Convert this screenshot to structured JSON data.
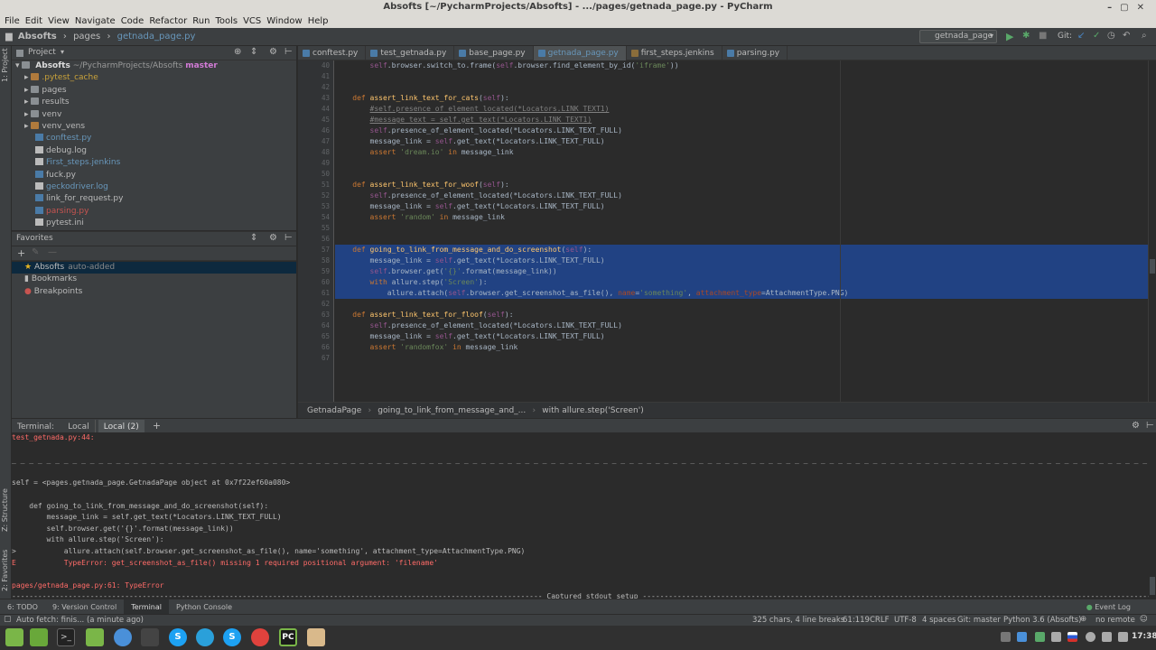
{
  "window": {
    "title": "Absofts [~/PycharmProjects/Absofts] - .../pages/getnada_page.py - PyCharm"
  },
  "menu": [
    "File",
    "Edit",
    "View",
    "Navigate",
    "Code",
    "Refactor",
    "Run",
    "Tools",
    "VCS",
    "Window",
    "Help"
  ],
  "nav": {
    "crumbs": [
      "Absofts",
      "pages",
      "getnada_page.py"
    ],
    "run_config": "getnada_page",
    "git_label": "Git:"
  },
  "left_strip": {
    "project": "1: Project",
    "structure": "Z: Structure",
    "favorites": "2: Favorites"
  },
  "project": {
    "header": "Project",
    "root_name": "Absofts",
    "root_path": "~/PycharmProjects/Absofts",
    "root_branch": "master",
    "items": [
      {
        "name": ".pytest_cache",
        "kind": "folder-orange",
        "color": "#c9a23a"
      },
      {
        "name": "pages",
        "kind": "folder",
        "color": "#bbbbbb"
      },
      {
        "name": "results",
        "kind": "folder",
        "color": "#bbbbbb"
      },
      {
        "name": "venv",
        "kind": "folder",
        "color": "#bbbbbb"
      },
      {
        "name": "venv_vens",
        "kind": "folder-orange",
        "color": "#bbbbbb"
      },
      {
        "name": "conftest.py",
        "kind": "py",
        "color": "#6897bb"
      },
      {
        "name": "debug.log",
        "kind": "txt",
        "color": "#bbbbbb"
      },
      {
        "name": "First_steps.jenkins",
        "kind": "txt",
        "color": "#6897bb"
      },
      {
        "name": "fuck.py",
        "kind": "py",
        "color": "#bbbbbb"
      },
      {
        "name": "geckodriver.log",
        "kind": "txt",
        "color": "#6897bb"
      },
      {
        "name": "link_for_request.py",
        "kind": "py",
        "color": "#bbbbbb"
      },
      {
        "name": "parsing.py",
        "kind": "py",
        "color": "#c75450"
      },
      {
        "name": "pytest.ini",
        "kind": "txt",
        "color": "#bbbbbb"
      }
    ]
  },
  "favorites": {
    "header": "Favorites",
    "items": [
      {
        "name": "Absofts",
        "note": "auto-added",
        "icon": "star-icon"
      },
      {
        "name": "Bookmarks",
        "note": "",
        "icon": "bookmark-icon"
      },
      {
        "name": "Breakpoints",
        "note": "",
        "icon": "breakpoint-icon"
      }
    ]
  },
  "editor": {
    "tabs": [
      {
        "label": "conftest.py",
        "active": false
      },
      {
        "label": "test_getnada.py",
        "active": false
      },
      {
        "label": "base_page.py",
        "active": false
      },
      {
        "label": "getnada_page.py",
        "active": true
      },
      {
        "label": "first_steps.jenkins",
        "active": false
      },
      {
        "label": "parsing.py",
        "active": false
      }
    ],
    "lines": [
      {
        "n": "40",
        "html": "        <span class=\"slf\">self</span>.browser.switch_to.frame(<span class=\"slf\">self</span>.browser.find_element_by_id(<span class=\"str\">'iframe'</span>))",
        "sel": false
      },
      {
        "n": "41",
        "html": "",
        "sel": false
      },
      {
        "n": "42",
        "html": "",
        "sel": false
      },
      {
        "n": "43",
        "html": "    <span class=\"kw\">def</span> <span class=\"fn\">assert_link_text_for_cats</span>(<span class=\"slf\">self</span>):",
        "sel": false
      },
      {
        "n": "44",
        "html": "        <span class=\"cmt\">#self.presence_of_element_located(*Locators.LINK_TEXT1)</span>",
        "sel": false
      },
      {
        "n": "45",
        "html": "        <span class=\"cmt\">#message_text = self.get_text(*Locators.LINK_TEXT1)</span>",
        "sel": false
      },
      {
        "n": "46",
        "html": "        <span class=\"slf\">self</span>.presence_of_element_located(*Locators.LINK_TEXT_FULL)",
        "sel": false
      },
      {
        "n": "47",
        "html": "        message_link = <span class=\"slf\">self</span>.get_text(*Locators.LINK_TEXT_FULL)",
        "sel": false
      },
      {
        "n": "48",
        "html": "        <span class=\"kw\">assert</span> <span class=\"str\">'dream.io'</span> <span class=\"kw\">in</span> message_link",
        "sel": false
      },
      {
        "n": "49",
        "html": "",
        "sel": false
      },
      {
        "n": "50",
        "html": "",
        "sel": false
      },
      {
        "n": "51",
        "html": "    <span class=\"kw\">def</span> <span class=\"fn\">assert_link_text_for_woof</span>(<span class=\"slf\">self</span>):",
        "sel": false
      },
      {
        "n": "52",
        "html": "        <span class=\"slf\">self</span>.presence_of_element_located(*Locators.LINK_TEXT_FULL)",
        "sel": false
      },
      {
        "n": "53",
        "html": "        message_link = <span class=\"slf\">self</span>.get_text(*Locators.LINK_TEXT_FULL)",
        "sel": false
      },
      {
        "n": "54",
        "html": "        <span class=\"kw\">assert</span> <span class=\"str\">'random'</span> <span class=\"kw\">in</span> message_link",
        "sel": false
      },
      {
        "n": "55",
        "html": "",
        "sel": false
      },
      {
        "n": "56",
        "html": "",
        "sel": false
      },
      {
        "n": "57",
        "html": "    <span class=\"kw\">def</span> <span class=\"fn\">going_to_link_from_message_and_do_screenshot</span>(<span class=\"slf\">self</span>):",
        "sel": true
      },
      {
        "n": "58",
        "html": "        message_link = <span class=\"slf\">self</span>.get_text(*Locators.LINK_TEXT_FULL)",
        "sel": true
      },
      {
        "n": "59",
        "html": "        <span class=\"slf\">self</span>.browser.get(<span class=\"str\">'{}'</span>.format(message_link))",
        "sel": true
      },
      {
        "n": "60",
        "html": "        <span class=\"kw\">with</span> allure.step(<span class=\"str\">'Screen'</span>):",
        "sel": true
      },
      {
        "n": "61",
        "html": "            allure.attach(<span class=\"slf\">self</span>.browser.get_screenshot_as_file(), <span class=\"prm\">name</span>=<span class=\"str\">'something'</span>, <span class=\"prm\">attachment_type</span>=AttachmentType.PNG)",
        "sel": true
      },
      {
        "n": "62",
        "html": "",
        "sel": false
      },
      {
        "n": "63",
        "html": "    <span class=\"kw\">def</span> <span class=\"fn\">assert_link_text_for_floof</span>(<span class=\"slf\">self</span>):",
        "sel": false
      },
      {
        "n": "64",
        "html": "        <span class=\"slf\">self</span>.presence_of_element_located(*Locators.LINK_TEXT_FULL)",
        "sel": false
      },
      {
        "n": "65",
        "html": "        message_link = <span class=\"slf\">self</span>.get_text(*Locators.LINK_TEXT_FULL)",
        "sel": false
      },
      {
        "n": "66",
        "html": "        <span class=\"kw\">assert</span> <span class=\"str\">'randomfox'</span> <span class=\"kw\">in</span> message_link",
        "sel": false
      },
      {
        "n": "67",
        "html": "",
        "sel": false
      }
    ],
    "breadcrumbs": [
      "GetnadaPage",
      "going_to_link_from_message_and_...",
      "with allure.step('Screen')"
    ]
  },
  "terminal": {
    "label": "Terminal:",
    "tabs": [
      "Local",
      "Local (2)"
    ],
    "lines": [
      {
        "text": "test_getnada.py:44:",
        "cls": "red"
      },
      {
        "text": "",
        "cls": ""
      },
      {
        "text": "_ _ _ _ _ _ _ _ _ _ _ _ _ _ _ _ _ _ _ _ _ _ _ _ _ _ _ _ _ _ _ _ _ _ _ _ _ _ _ _ _ _ _ _ _ _ _ _ _ _ _ _ _ _ _ _ _ _ _ _ _ _ _ _ _ _ _ _ _ _ _ _ _ _ _ _ _ _ _ _ _ _ _ _ _ _ _ _ _ _ _ _ _ _ _ _ _ _ _ _ _ _ _ _ _ _ _ _ _ _ _ _ _ _ _ _ _ _ _ _ _ _ _ _ _ _ _ _ _ _ _ _ _ _ _ _ _ _ _ _ _",
        "cls": ""
      },
      {
        "text": "",
        "cls": ""
      },
      {
        "text": "self = <pages.getnada_page.GetnadaPage object at 0x7f22ef60a080>",
        "cls": ""
      },
      {
        "text": "",
        "cls": ""
      },
      {
        "text": "    def going_to_link_from_message_and_do_screenshot(self):",
        "cls": ""
      },
      {
        "text": "        message_link = self.get_text(*Locators.LINK_TEXT_FULL)",
        "cls": ""
      },
      {
        "text": "        self.browser.get('{}'.format(message_link))",
        "cls": ""
      },
      {
        "text": "        with allure.step('Screen'):",
        "cls": ""
      },
      {
        "text": ">           allure.attach(self.browser.get_screenshot_as_file(), name='something', attachment_type=AttachmentType.PNG)",
        "cls": ""
      },
      {
        "text": "E           TypeError: get_screenshot_as_file() missing 1 required positional argument: 'filename'",
        "cls": "red"
      },
      {
        "text": "",
        "cls": ""
      },
      {
        "text": "pages/getnada_page.py:61: TypeError",
        "cls": "red"
      },
      {
        "text": "-------------------------------------------------------------------------------------------------------------------------- Captured stdout setup ----------------------------------------------------------------------------------------------------------------------------",
        "cls": ""
      }
    ]
  },
  "bottom_tabs": [
    {
      "label": "6: TODO",
      "active": false
    },
    {
      "label": "9: Version Control",
      "active": false
    },
    {
      "label": "Terminal",
      "active": true
    },
    {
      "label": "Python Console",
      "active": false
    }
  ],
  "event_log": "Event Log",
  "status": {
    "left": "Auto fetch: finis... (a minute ago)",
    "chars": "325 chars, 4 line breaks",
    "pos": "61:119",
    "crlf": "CRLF",
    "enc": "UTF-8",
    "indent": "4 spaces",
    "git": "Git: master",
    "python": "Python 3.6 (Absofts)",
    "remote": "no remote"
  },
  "taskbar": {
    "clock": "17:38"
  },
  "colors": {
    "selection": "#214283",
    "bg": "#2b2b2b",
    "panel": "#3c3f41"
  }
}
